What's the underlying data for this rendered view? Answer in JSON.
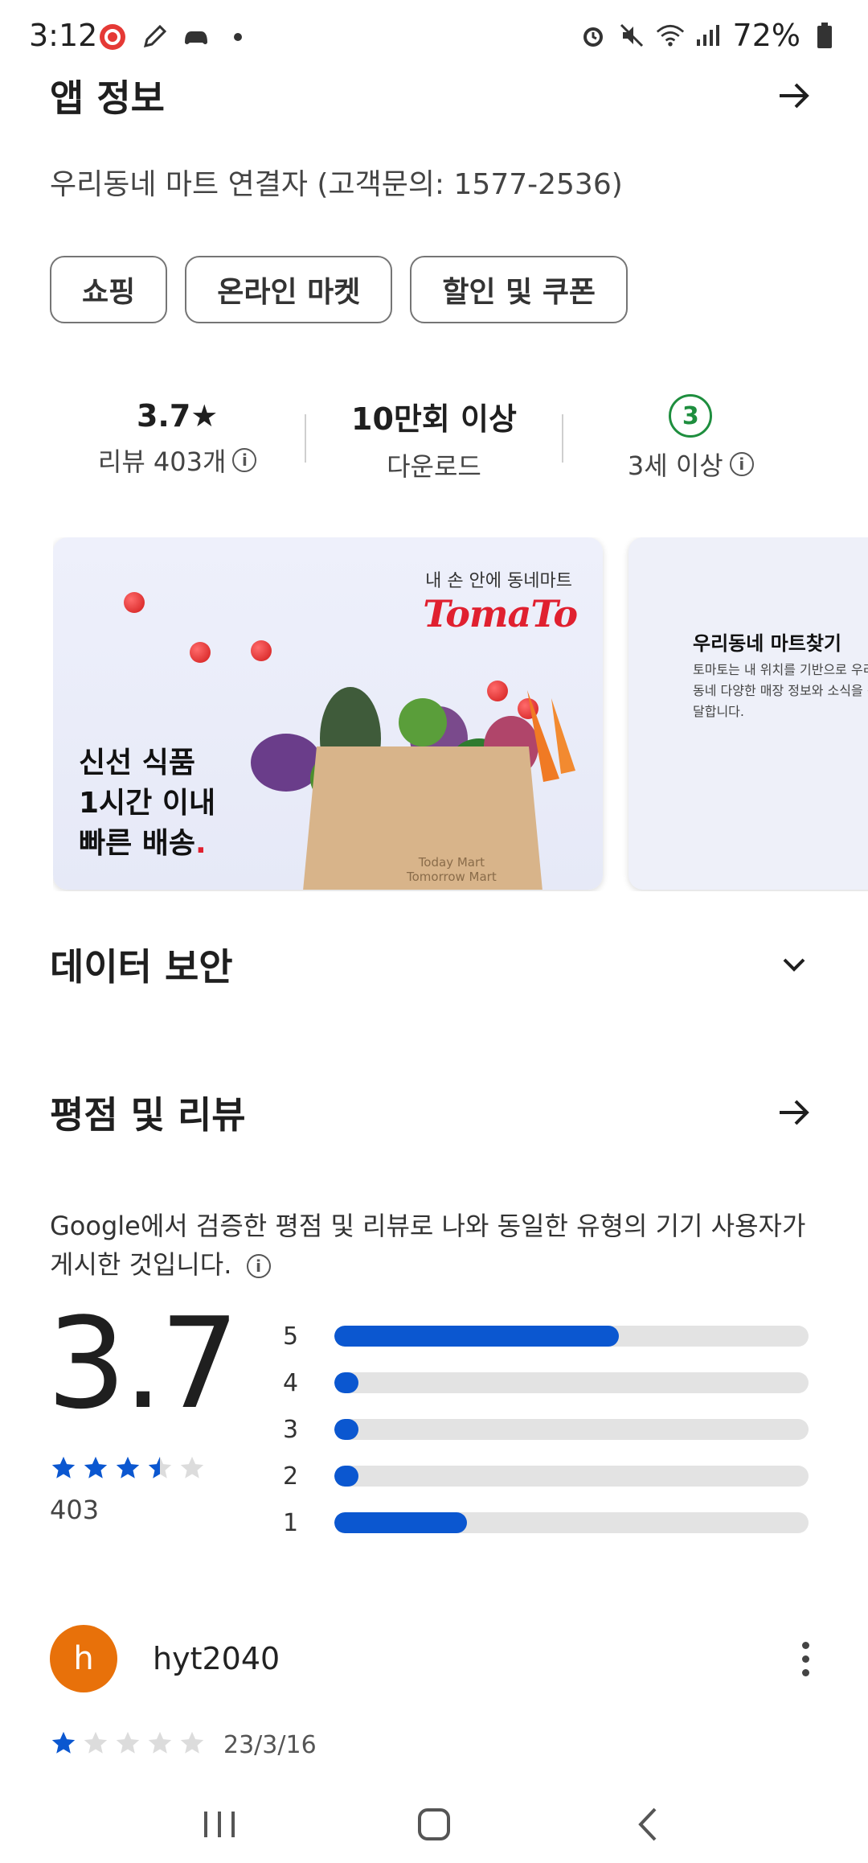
{
  "status_bar": {
    "time": "3:12",
    "battery": "72%"
  },
  "app_info": {
    "title": "앱 정보",
    "developer": "우리동네 마트 연결자 (고객문의: 1577-2536)",
    "chips": [
      "쇼핑",
      "온라인 마켓",
      "할인 및 쿠폰"
    ]
  },
  "stats": {
    "rating": "3.7★",
    "reviews": "리뷰 403개",
    "downloads": "10만회 이상",
    "downloads_label": "다운로드",
    "age_badge": "3",
    "age_label": "3세 이상"
  },
  "screenshots": {
    "shot1": {
      "tag": "내 손 안에 동네마트",
      "logo": "TomaTo",
      "headline_1": "신선 식품",
      "headline_2": "1시간 이내",
      "headline_3": "빠른 배송",
      "dot": ".",
      "bag_line1": "Today Mart",
      "bag_line2": "Tomorrow Mart"
    },
    "shot2": {
      "title": "우리동네 마트찾기",
      "body": "토마토는 내 위치를 기반으로 우리동네 다양한 매장 정보와 소식을 전달합니다."
    }
  },
  "data_safety": {
    "title": "데이터 보안"
  },
  "ratings": {
    "title": "평점 및 리뷰",
    "description": "Google에서 검증한 평점 및 리뷰로 나와 동일한 유형의 기기 사용자가 게시한 것입니다.",
    "average": "3.7",
    "stars": 3.5,
    "total": "403",
    "distribution": [
      {
        "label": "5",
        "fraction": 0.6
      },
      {
        "label": "4",
        "fraction": 0.05
      },
      {
        "label": "3",
        "fraction": 0.05
      },
      {
        "label": "2",
        "fraction": 0.05
      },
      {
        "label": "1",
        "fraction": 0.28
      }
    ]
  },
  "review": {
    "avatar_letter": "h",
    "author": "hyt2040",
    "stars": 1,
    "date": "23/3/16"
  },
  "colors": {
    "accent": "#0b57d0",
    "avatar": "#e8710a",
    "age_badge": "#1e8e3e",
    "logo": "#e0202f"
  }
}
